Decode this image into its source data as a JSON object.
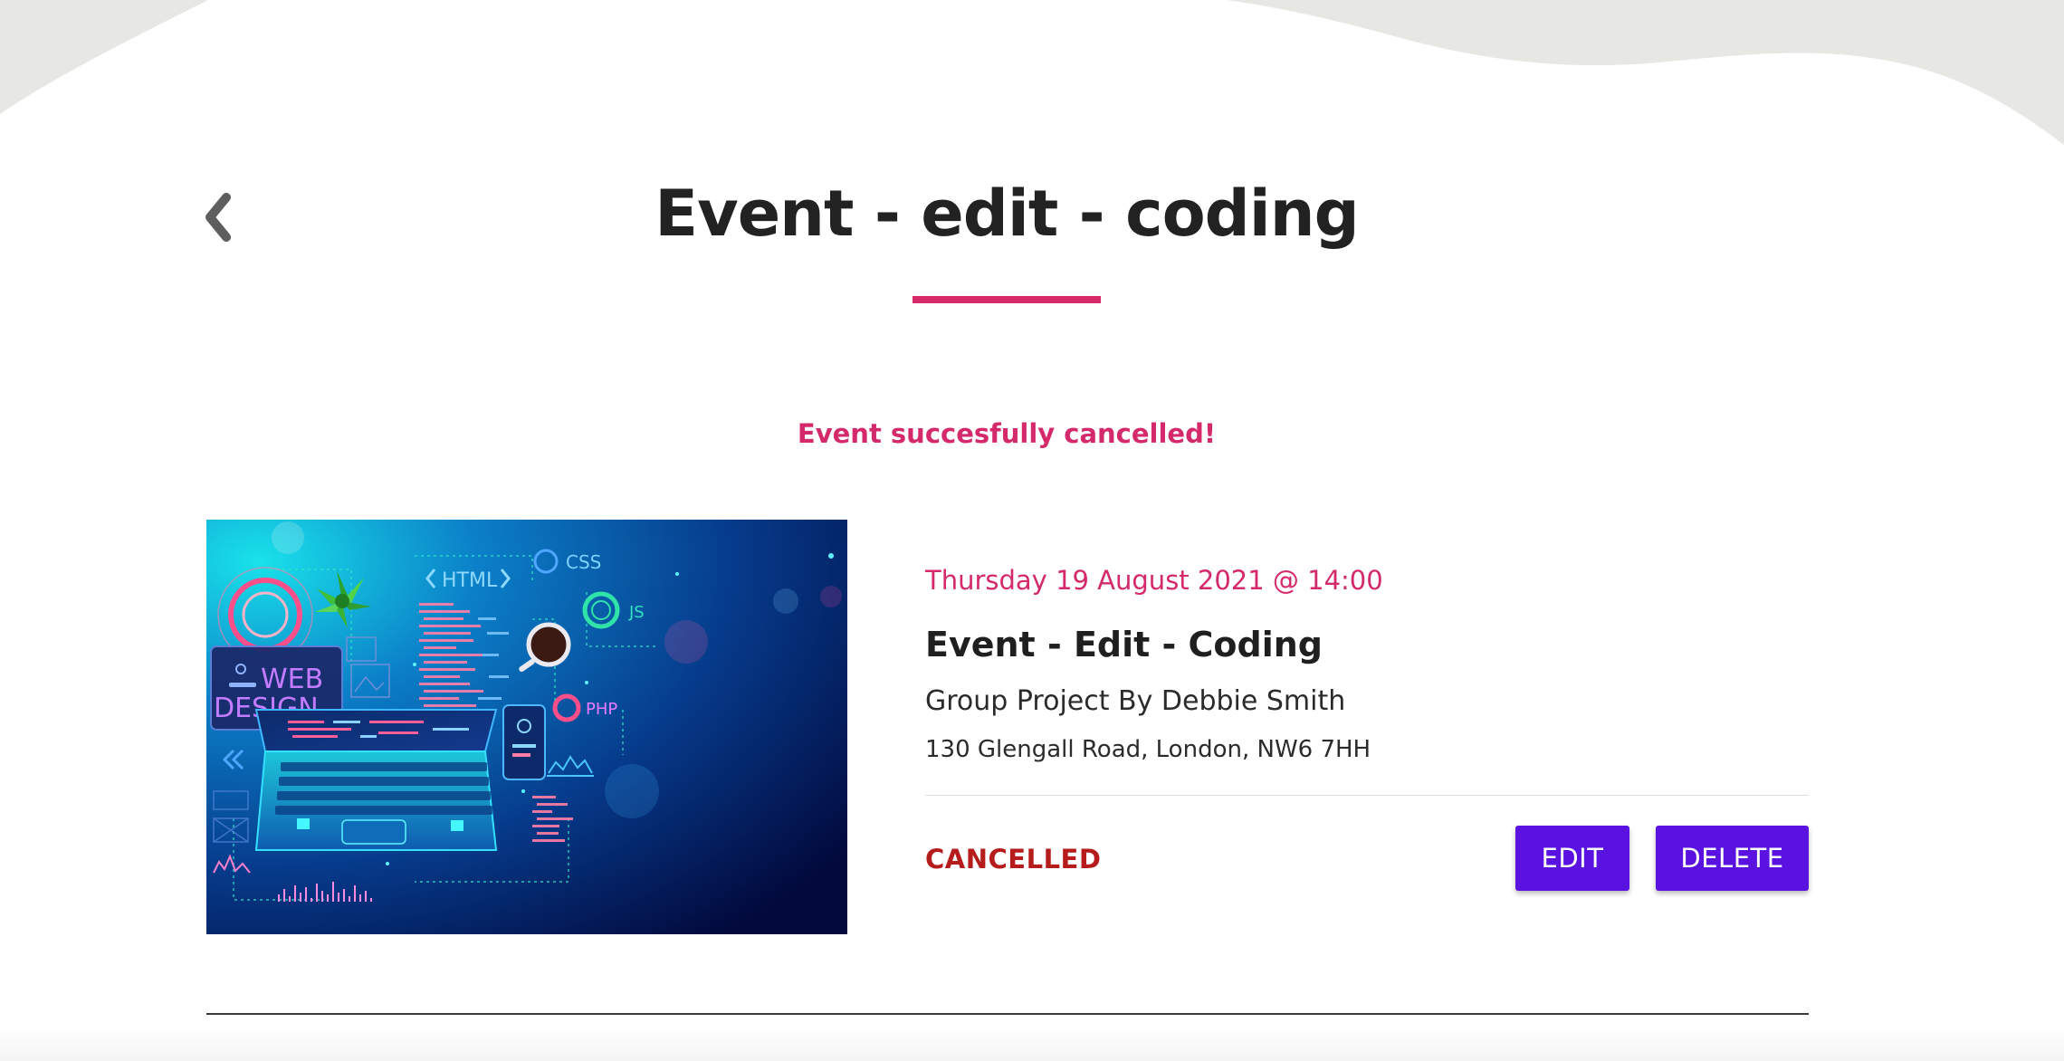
{
  "header": {
    "back_icon": "chevron-left-icon",
    "title": "Event - edit - coding"
  },
  "flash": {
    "message": "Event succesfully cancelled!"
  },
  "event": {
    "image_alt": "Coding illustration with laptop, HTML, CSS, JS and PHP",
    "image_labels": {
      "web": "WEB",
      "design": "DESIGN",
      "html": "HTML",
      "css": "CSS",
      "js": "JS",
      "php": "PHP"
    },
    "date": "Thursday 19 August 2021 @ 14:00",
    "name": "Event - Edit - Coding",
    "organiser": "Group Project By Debbie Smith",
    "address": "130 Glengall Road, London, NW6 7HH",
    "status": "CANCELLED",
    "edit_label": "EDIT",
    "delete_label": "DELETE"
  },
  "colors": {
    "accent": "#d42a6b",
    "button": "#5a12e0",
    "status_cancelled": "#b71c1c",
    "wave": "#e7e8e3"
  }
}
